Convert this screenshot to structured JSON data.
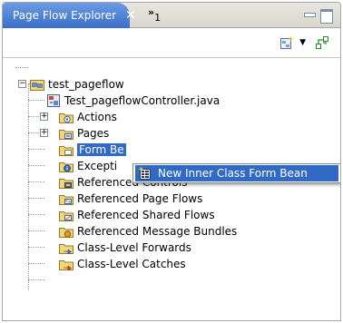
{
  "panel": {
    "tab_title": "Page Flow Explorer",
    "tab_close": "✕",
    "overflow_chevron": "»",
    "overflow_count": "1"
  },
  "tree": {
    "root": "test_pageflow",
    "items": [
      {
        "label": "Test_pageflowController.java",
        "icon": "java-file-icon"
      },
      {
        "label": "Actions",
        "icon": "actions-folder-icon"
      },
      {
        "label": "Pages",
        "icon": "pages-folder-icon"
      },
      {
        "label": "Form Be",
        "icon": "form-beans-folder-icon"
      },
      {
        "label": "Excepti",
        "icon": "exceptions-folder-icon"
      },
      {
        "label": "Referenced Controls",
        "icon": "controls-folder-icon"
      },
      {
        "label": "Referenced Page Flows",
        "icon": "page-flows-folder-icon"
      },
      {
        "label": "Referenced Shared Flows",
        "icon": "shared-flows-folder-icon"
      },
      {
        "label": "Referenced Message Bundles",
        "icon": "message-bundles-folder-icon"
      },
      {
        "label": "Class-Level Forwards",
        "icon": "forwards-folder-icon"
      },
      {
        "label": "Class-Level Catches",
        "icon": "catches-folder-icon"
      }
    ]
  },
  "context_menu": {
    "item_label": "New Inner Class Form Bean"
  },
  "colors": {
    "tab_blue": "#3a6fc9",
    "selection": "#316ac5",
    "folder_yellow": "#f2d67a"
  }
}
